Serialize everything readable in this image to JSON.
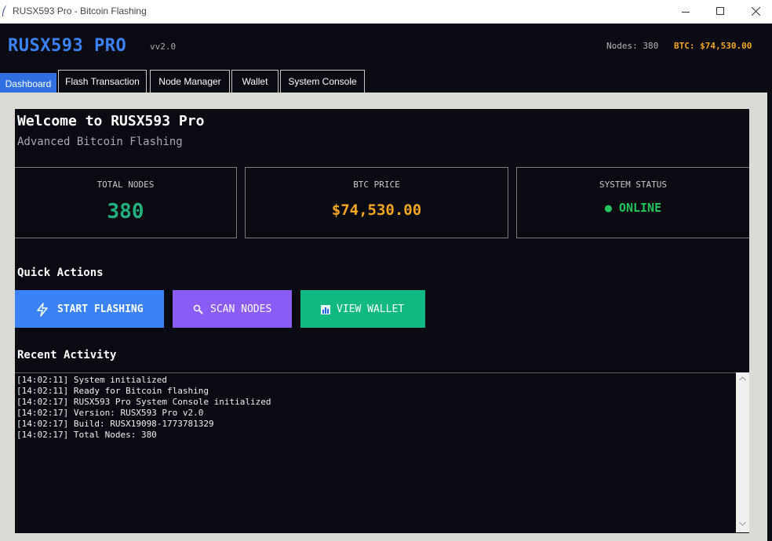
{
  "window": {
    "title": "RUSX593 Pro - Bitcoin Flashing",
    "icons": {
      "app": "feather-icon",
      "minimize": "minimize-icon",
      "maximize": "maximize-icon",
      "close": "close-icon"
    }
  },
  "header": {
    "brand": "RUSX593 PRO",
    "version": "vv2.0",
    "nodes_readout": "Nodes: 380",
    "btc_readout": "BTC: $74,530.00"
  },
  "tabs": [
    {
      "label": "Dashboard",
      "active": true
    },
    {
      "label": "Flash Transaction",
      "active": false
    },
    {
      "label": "Node Manager",
      "active": false
    },
    {
      "label": "Wallet",
      "active": false
    },
    {
      "label": "System Console",
      "active": false
    }
  ],
  "dashboard": {
    "welcome": "Welcome to RUSX593 Pro",
    "subtitle": "Advanced Bitcoin Flashing",
    "stats": {
      "nodes": {
        "label": "TOTAL NODES",
        "value": "380"
      },
      "btc": {
        "label": "BTC PRICE",
        "value": "$74,530.00"
      },
      "status": {
        "label": "SYSTEM STATUS",
        "value": "● ONLINE"
      }
    },
    "quick_actions_title": "Quick Actions",
    "actions": [
      {
        "label": "START FLASHING",
        "icon": "lightning-icon",
        "color": "#3b82f6"
      },
      {
        "label": "SCAN NODES",
        "icon": "magnifier-icon",
        "color": "#8b5cf6"
      },
      {
        "label": "VIEW WALLET",
        "icon": "bar-chart-icon",
        "color": "#10b981"
      }
    ],
    "recent_activity_title": "Recent Activity",
    "log": "[14:02:11] System initialized\n[14:02:11] Ready for Bitcoin flashing\n[14:02:17] RUSX593 Pro System Console initialized\n[14:02:17] Version: RUSX593 Pro v2.0\n[14:02:17] Build: RUSX19098-1773781329\n[14:02:17] Total Nodes: 380"
  },
  "colors": {
    "background": "#0a0a12",
    "brand": "#3b82f6",
    "accent_orange": "#f5a623",
    "accent_green": "#22b07d",
    "online_green": "#22c55e",
    "frame": "#dcdad5"
  }
}
